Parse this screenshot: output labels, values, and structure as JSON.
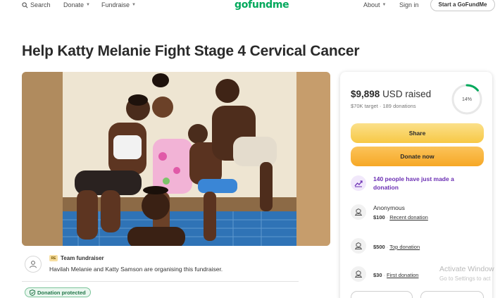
{
  "nav": {
    "search": "Search",
    "donate": "Donate",
    "fundraise": "Fundraise",
    "logo": "gofundme",
    "about": "About",
    "sign_in": "Sign in",
    "start": "Start a GoFundMe"
  },
  "campaign": {
    "title": "Help Katty Melanie Fight Stage 4 Cervical Cancer",
    "organizer": {
      "badge_icon_text": "RE",
      "badge": "Team fundraiser",
      "text": "Havilah Melanie and Katty Samson are organising this fundraiser."
    },
    "protected": "Donation protected"
  },
  "card": {
    "raised_amount": "$9,898",
    "raised_label": "USD raised",
    "target": "$70K target",
    "separator": "·",
    "donations": "189 donations",
    "progress_percent": 14,
    "progress_label": "14%",
    "share_label": "Share",
    "donate_label": "Donate now",
    "activity": "140 people have just made a donation",
    "donations_list": [
      {
        "name": "Anonymous",
        "amount": "$100",
        "tag": "Recent donation"
      },
      {
        "name": "",
        "amount": "$500",
        "tag": "Top donation"
      },
      {
        "name": "",
        "amount": "$30",
        "tag": "First donation"
      }
    ]
  },
  "watermark": {
    "line1": "Activate Window",
    "line2": "Go to Settings to act"
  },
  "colors": {
    "brand": "#02a95c",
    "share": "#f7c845",
    "donate": "#f6a826",
    "activity": "#6b2fb3"
  }
}
